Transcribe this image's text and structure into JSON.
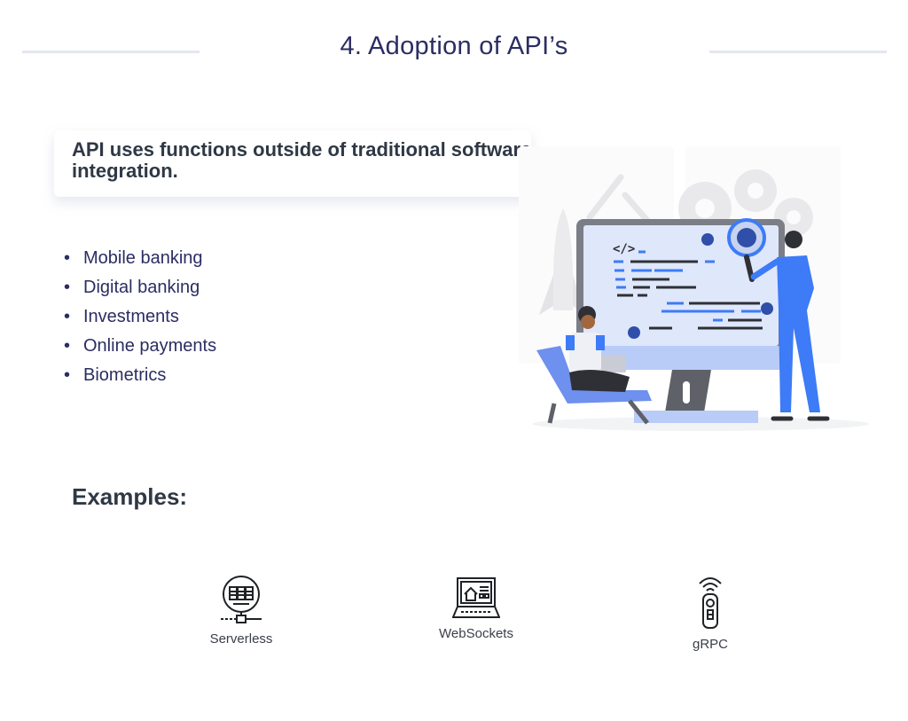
{
  "header": {
    "title": "4. Adoption of API’s"
  },
  "intro": {
    "text": "API uses functions outside of traditional software integration."
  },
  "use_cases": [
    "Mobile banking",
    "Digital banking",
    "Investments",
    "Online payments",
    "Biometrics"
  ],
  "illustration": {
    "alt": "developers debugging code on a large monitor",
    "code_tag": "</>",
    "colors": {
      "accent": "#3d7bf7",
      "screen": "#dfe7fb",
      "dark": "#2f3036"
    }
  },
  "examples": {
    "heading": "Examples:",
    "items": [
      {
        "label": "Serverless",
        "icon": "server-network-icon"
      },
      {
        "label": "WebSockets",
        "icon": "laptop-web-icon"
      },
      {
        "label": "gRPC",
        "icon": "remote-signal-icon"
      }
    ]
  }
}
